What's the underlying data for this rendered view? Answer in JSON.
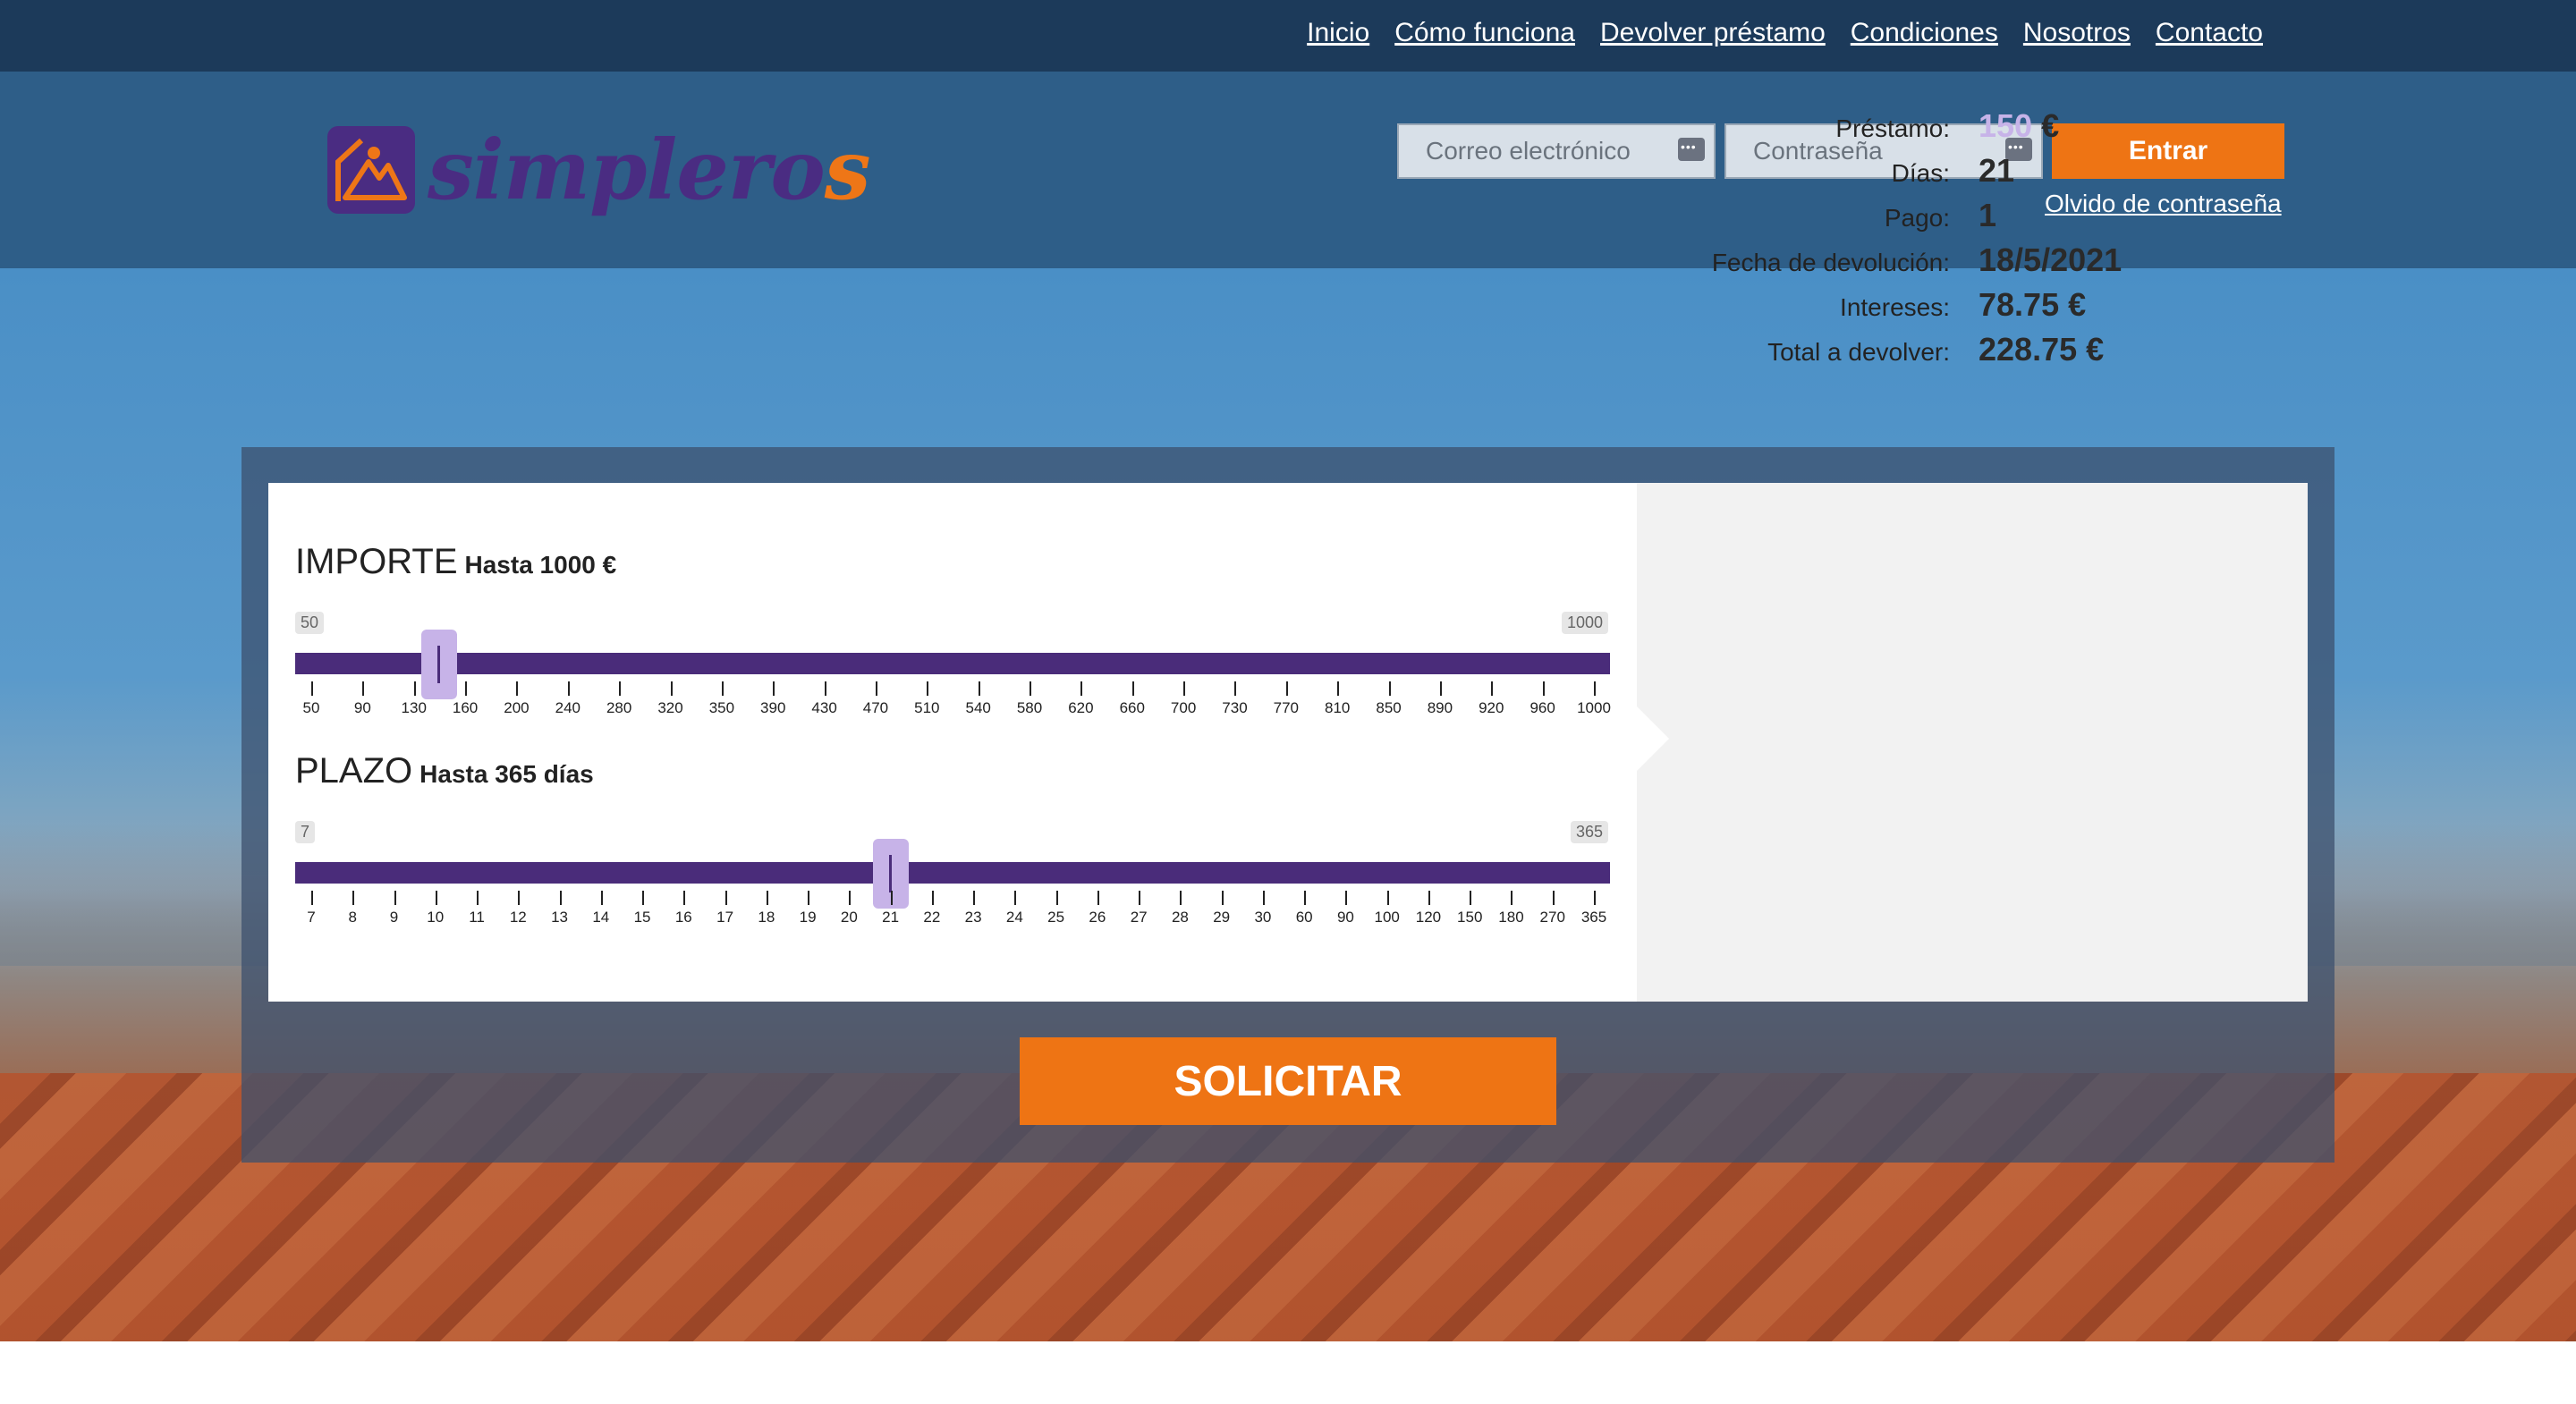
{
  "nav": {
    "links": [
      "Inicio",
      "Cómo funciona",
      "Devolver préstamo",
      "Condiciones",
      "Nosotros",
      "Contacto"
    ]
  },
  "brand": {
    "name_main": "simplero",
    "name_last": "s"
  },
  "login": {
    "email_placeholder": "Correo electrónico",
    "password_placeholder": "Contraseña",
    "submit_label": "Entrar",
    "forgot_label": "Olvido de contraseña"
  },
  "importe": {
    "title": "IMPORTE",
    "subtitle": "Hasta 1000 €",
    "min": "50",
    "max": "1000",
    "ticks": [
      "50",
      "90",
      "130",
      "160",
      "200",
      "240",
      "280",
      "320",
      "350",
      "390",
      "430",
      "470",
      "510",
      "540",
      "580",
      "620",
      "660",
      "700",
      "730",
      "770",
      "810",
      "850",
      "890",
      "920",
      "960",
      "1000"
    ],
    "selected_index": 2.5
  },
  "plazo": {
    "title": "PLAZO",
    "subtitle": "Hasta 365 días",
    "min": "7",
    "max": "365",
    "ticks": [
      "7",
      "8",
      "9",
      "10",
      "11",
      "12",
      "13",
      "14",
      "15",
      "16",
      "17",
      "18",
      "19",
      "20",
      "21",
      "22",
      "23",
      "24",
      "25",
      "26",
      "27",
      "28",
      "29",
      "30",
      "60",
      "90",
      "100",
      "120",
      "150",
      "180",
      "270",
      "365"
    ],
    "selected_index": 14
  },
  "summary": {
    "prestamo_label": "Préstamo:",
    "prestamo_value": "150",
    "prestamo_currency": "€",
    "dias_label": "Días:",
    "dias_value": "21",
    "pago_label": "Pago:",
    "pago_value": "1",
    "fecha_label": "Fecha de devolución:",
    "fecha_value": "18/5/2021",
    "intereses_label": "Intereses:",
    "intereses_value": "78.75 €",
    "total_label": "Total a devolver:",
    "total_value": "228.75 €"
  },
  "cta": {
    "label": "SOLICITAR"
  },
  "colors": {
    "accent": "#ee7414",
    "brand": "#4a2c7a",
    "thumb": "#c7b3e8"
  }
}
